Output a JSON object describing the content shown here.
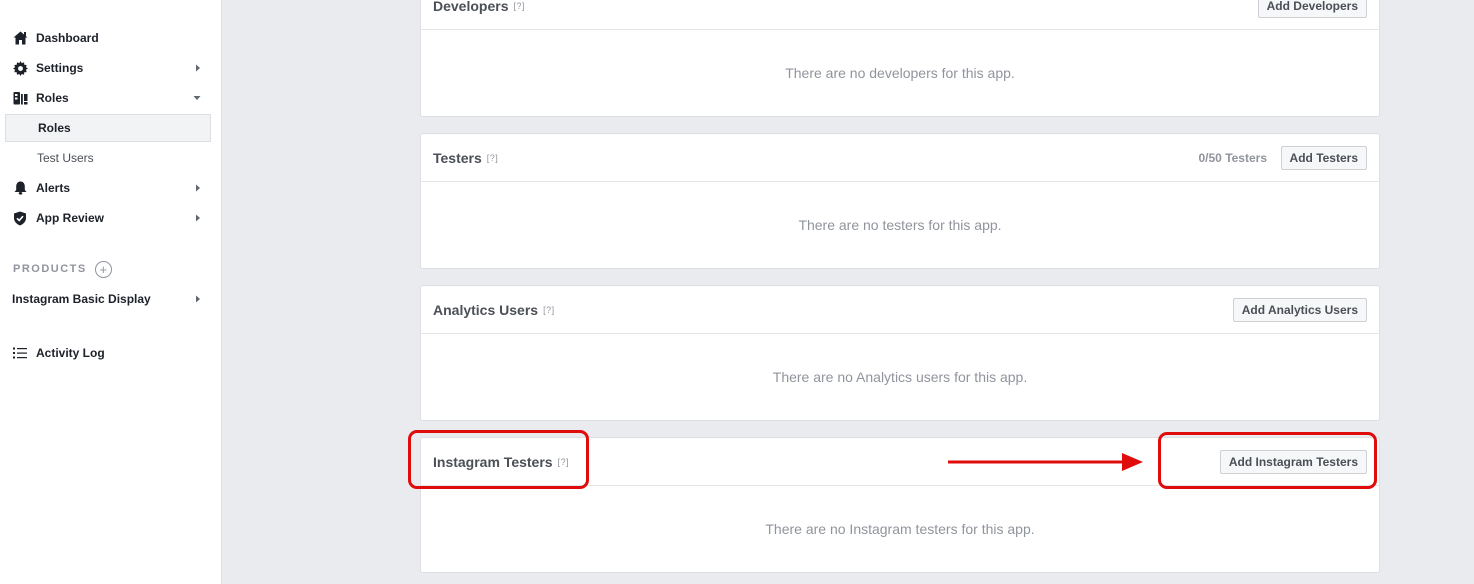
{
  "sidebar": {
    "items": [
      {
        "label": "Dashboard",
        "icon": "home-icon"
      },
      {
        "label": "Settings",
        "icon": "gear-icon"
      },
      {
        "label": "Roles",
        "icon": "roles-icon"
      },
      {
        "label": "Alerts",
        "icon": "bell-icon"
      },
      {
        "label": "App Review",
        "icon": "shield-check-icon"
      }
    ],
    "roles_sub": [
      {
        "label": "Roles",
        "active": true
      },
      {
        "label": "Test Users",
        "active": false
      }
    ],
    "products_header": "PRODUCTS",
    "products": [
      {
        "label": "Instagram Basic Display"
      }
    ],
    "activity_log": "Activity Log"
  },
  "panels": {
    "developers": {
      "title": "Developers",
      "help": "[?]",
      "button": "Add Developers",
      "empty": "There are no developers for this app."
    },
    "testers": {
      "title": "Testers",
      "help": "[?]",
      "count": "0/50 Testers",
      "button": "Add Testers",
      "empty": "There are no testers for this app."
    },
    "analytics": {
      "title": "Analytics Users",
      "help": "[?]",
      "button": "Add Analytics Users",
      "empty": "There are no Analytics users for this app."
    },
    "instagram": {
      "title": "Instagram Testers",
      "help": "[?]",
      "button": "Add Instagram Testers",
      "empty": "There are no Instagram testers for this app."
    }
  },
  "colors": {
    "annotation": "#e00b0b",
    "background": "#e9ebee"
  }
}
